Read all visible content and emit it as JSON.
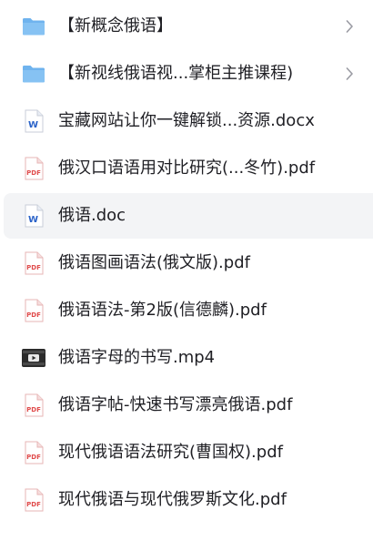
{
  "files": [
    {
      "name": "【新概念俄语】",
      "type": "folder",
      "icon": "folder-icon",
      "has_chevron": true
    },
    {
      "name": "【新视线俄语视...掌柜主推课程)",
      "type": "folder",
      "icon": "folder-icon",
      "has_chevron": true
    },
    {
      "name": "宝藏网站让你一键解锁...资源.docx",
      "type": "word",
      "icon": "word-doc-icon",
      "has_chevron": false
    },
    {
      "name": "俄汉口语语用对比研究(...冬竹).pdf",
      "type": "pdf",
      "icon": "pdf-icon",
      "has_chevron": false
    },
    {
      "name": "俄语.doc",
      "type": "word",
      "icon": "word-doc-icon",
      "has_chevron": false,
      "selected": true
    },
    {
      "name": "俄语图画语法(俄文版).pdf",
      "type": "pdf",
      "icon": "pdf-icon",
      "has_chevron": false
    },
    {
      "name": "俄语语法-第2版(信德麟).pdf",
      "type": "pdf",
      "icon": "pdf-icon",
      "has_chevron": false
    },
    {
      "name": "俄语字母的书写.mp4",
      "type": "video",
      "icon": "video-thumbnail-icon",
      "has_chevron": false
    },
    {
      "name": "俄语字帖-快速书写漂亮俄语.pdf",
      "type": "pdf",
      "icon": "pdf-icon",
      "has_chevron": false
    },
    {
      "name": "现代俄语语法研究(曹国权).pdf",
      "type": "pdf",
      "icon": "pdf-icon",
      "has_chevron": false
    },
    {
      "name": "现代俄语与现代俄罗斯文化.pdf",
      "type": "pdf",
      "icon": "pdf-icon",
      "has_chevron": false
    }
  ],
  "icon_badges": {
    "word": "W",
    "pdf": "PDF"
  },
  "colors": {
    "folder": "#6fb3ee",
    "word": "#2b63c9",
    "pdf": "#e04b4b",
    "selected_bg": "#f3f4f6",
    "text": "#1f1f24",
    "chevron": "#9a9ba3"
  }
}
